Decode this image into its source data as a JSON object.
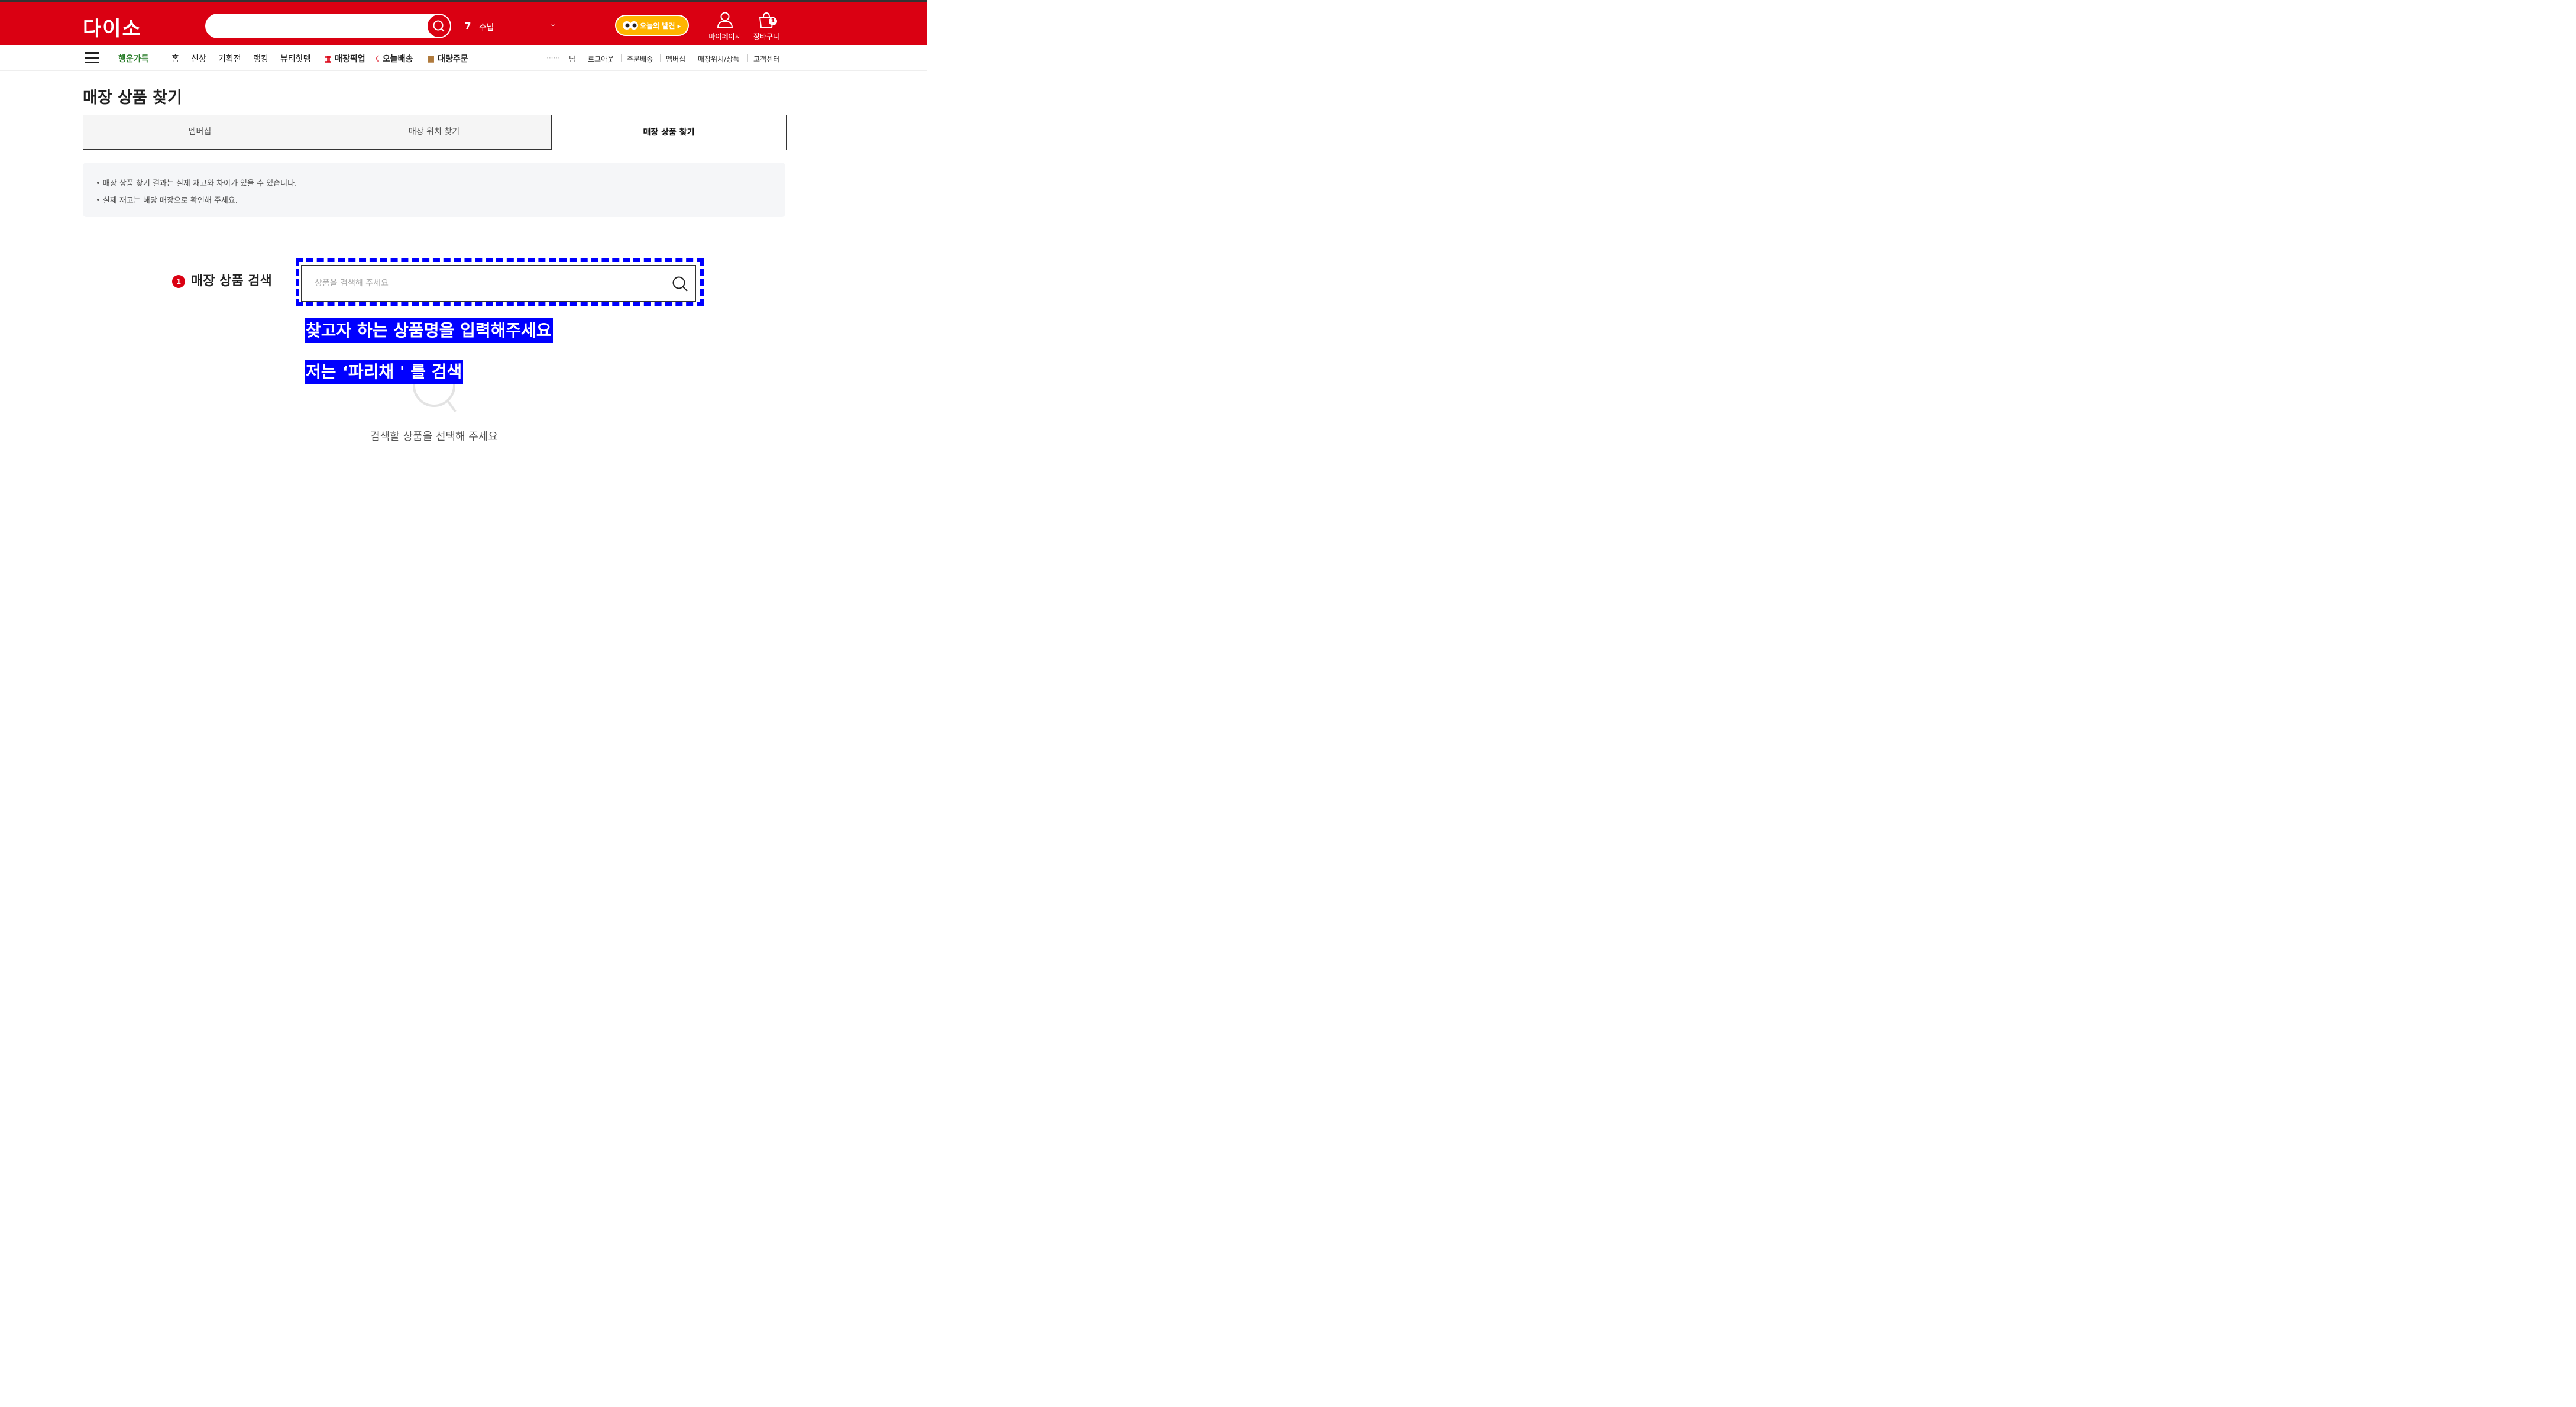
{
  "header": {
    "logo": "다이소",
    "location_number": "7",
    "location_name": "수납",
    "discover_label": "오늘의 발견 ▸",
    "mypage_label": "마이페이지",
    "cart_label": "장바구니",
    "cart_count": "1",
    "brand_color": "#da0012"
  },
  "nav": {
    "items": [
      "행운가득",
      "홈",
      "신상",
      "기획전",
      "랭킹",
      "뷰티핫템",
      "매장픽업",
      "오늘배송",
      "대량주문"
    ],
    "user_suffix": "님",
    "utility": [
      "로그아웃",
      "주문배송",
      "멤버십",
      "매장위치/상품",
      "고객센터"
    ]
  },
  "page": {
    "title": "매장 상품 찾기",
    "tabs": [
      "멤버십",
      "매장 위치 찾기",
      "매장 상품 찾기"
    ],
    "active_tab": "매장 상품 찾기",
    "notices": [
      "• 매장 상품 찾기 결과는 실제 재고와 차이가 있을 수 있습니다.",
      "• 실제 재고는 해당 매장으로 확인해 주세요."
    ],
    "section_number": "1",
    "section_label": "매장 상품 검색",
    "search_placeholder": "상품을 검색해 주세요",
    "empty_message": "검색할 상품을 선택해 주세요"
  },
  "annotations": {
    "line1": "찾고자 하는 상품명을 입력해주세요",
    "line2": "저는 ‘파리채 ' 를 검색",
    "highlight_color": "#0000ff"
  }
}
